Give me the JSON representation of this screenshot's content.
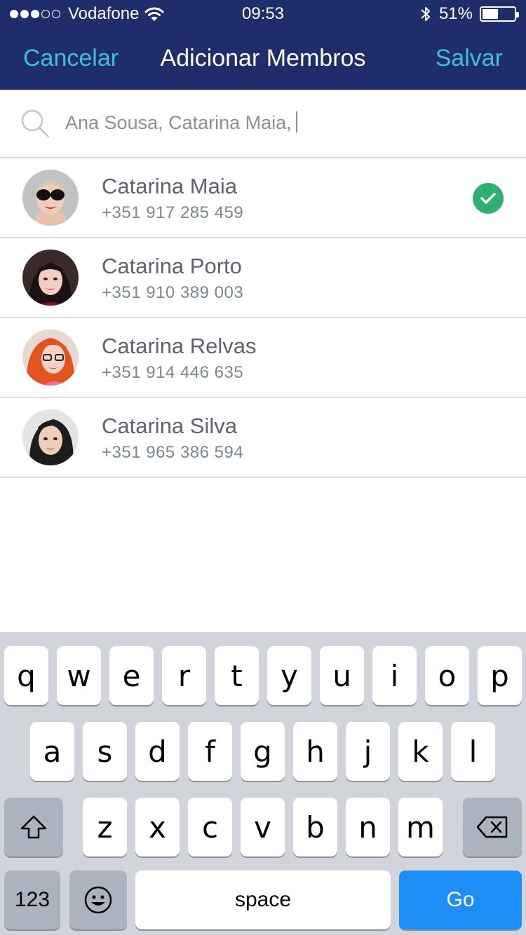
{
  "status_bar": {
    "carrier": "Vodafone",
    "time": "09:53",
    "battery_percent": "51%",
    "battery_level": 0.51,
    "signal_bars_filled": 3,
    "signal_bars_total": 5
  },
  "nav": {
    "cancel": "Cancelar",
    "title": "Adicionar Membros",
    "save": "Salvar"
  },
  "search": {
    "value": "Ana Sousa, Catarina Maia,"
  },
  "contacts": [
    {
      "name": "Catarina Maia",
      "phone": "+351 917 285 459",
      "selected": true
    },
    {
      "name": "Catarina Porto",
      "phone": "+351 910 389 003",
      "selected": false
    },
    {
      "name": "Catarina Relvas",
      "phone": "+351 914 446 635",
      "selected": false
    },
    {
      "name": "Catarina Silva",
      "phone": "+351 965 386 594",
      "selected": false
    }
  ],
  "keyboard": {
    "row1": [
      "q",
      "w",
      "e",
      "r",
      "t",
      "y",
      "u",
      "i",
      "o",
      "p"
    ],
    "row2": [
      "a",
      "s",
      "d",
      "f",
      "g",
      "h",
      "j",
      "k",
      "l"
    ],
    "row3": [
      "z",
      "x",
      "c",
      "v",
      "b",
      "n",
      "m"
    ],
    "numbers_label": "123",
    "space_label": "space",
    "go_label": "Go"
  },
  "colors": {
    "header_bg": "#1f2e6b",
    "nav_accent": "#3cc0d9",
    "check_green": "#2fb070",
    "go_blue": "#1e8ef7"
  }
}
